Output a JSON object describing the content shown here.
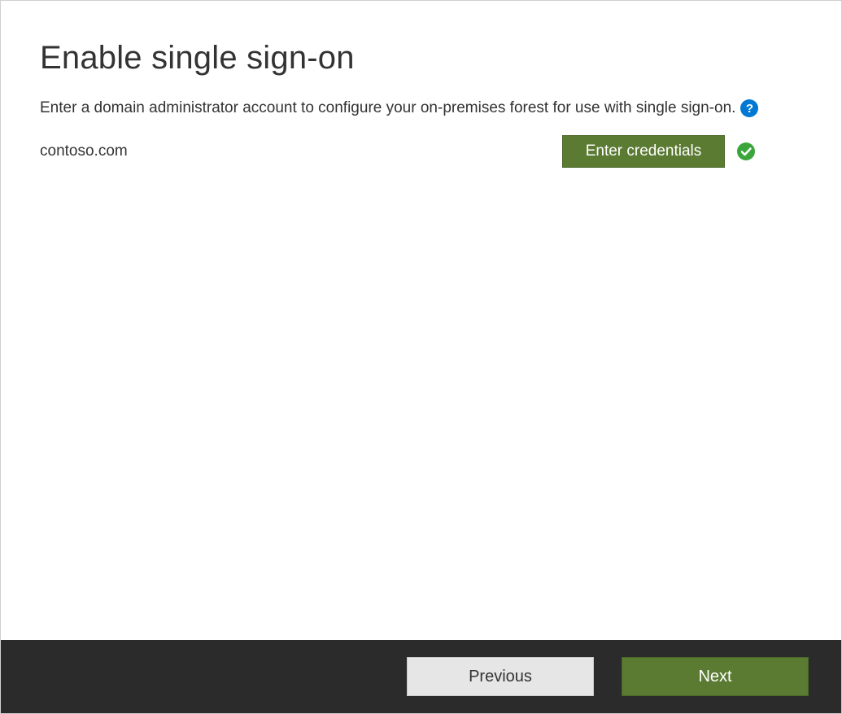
{
  "header": {
    "title": "Enable single sign-on",
    "description": "Enter a domain administrator account to configure your on-premises forest for use with single sign-on."
  },
  "domain": {
    "name": "contoso.com",
    "credentials_button_label": "Enter credentials",
    "status": "verified"
  },
  "footer": {
    "previous_label": "Previous",
    "next_label": "Next"
  },
  "icons": {
    "help_glyph": "?",
    "check": "success"
  },
  "colors": {
    "accent_green": "#5b7b33",
    "help_blue": "#0078d4",
    "success_green": "#3aa63a",
    "footer_bg": "#2b2b2b"
  }
}
